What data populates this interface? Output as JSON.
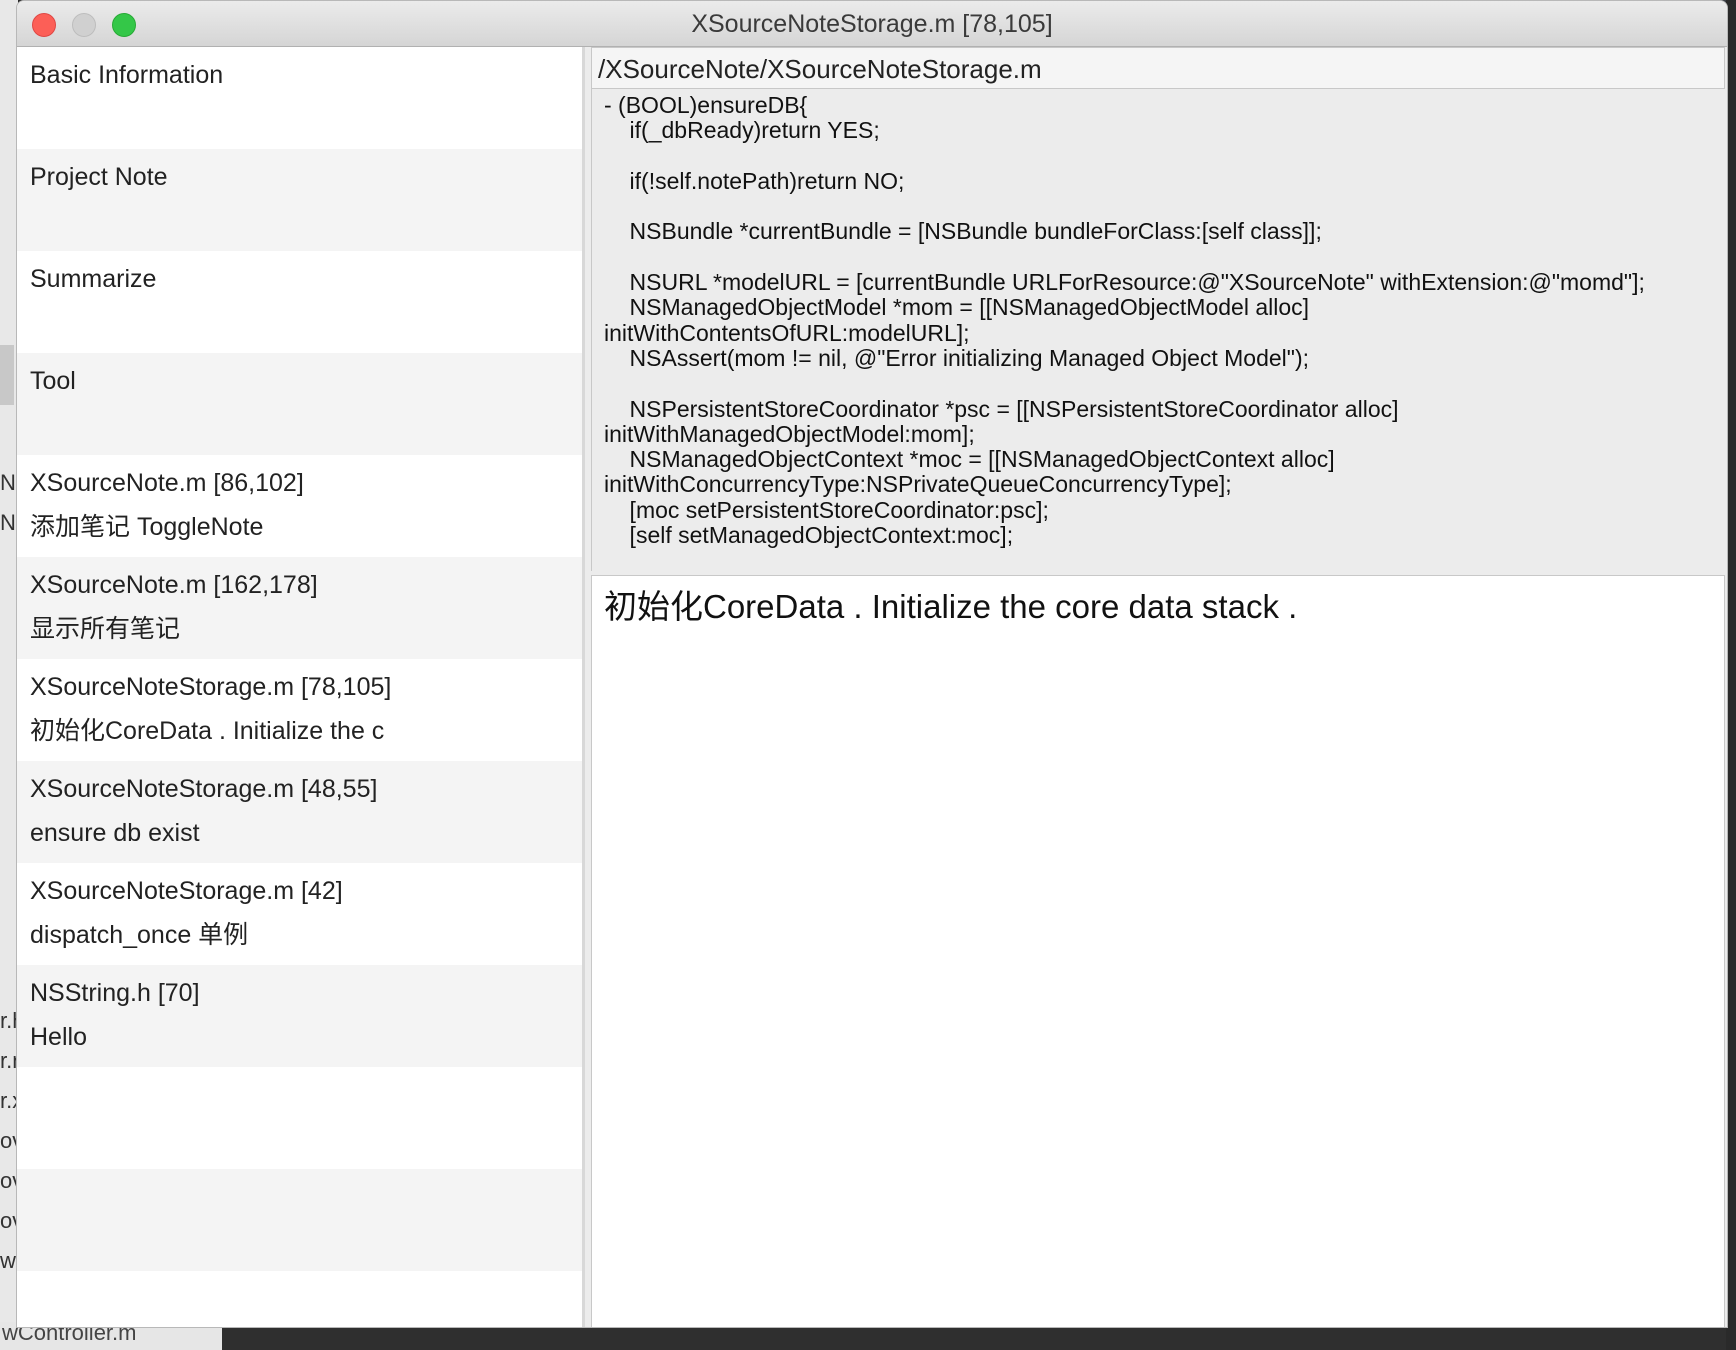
{
  "window": {
    "title": "XSourceNoteStorage.m [78,105]"
  },
  "sidebar": {
    "items": [
      {
        "title": "Basic Information",
        "subtitle": ""
      },
      {
        "title": "Project Note",
        "subtitle": ""
      },
      {
        "title": "Summarize",
        "subtitle": ""
      },
      {
        "title": "Tool",
        "subtitle": ""
      },
      {
        "title": "XSourceNote.m [86,102]",
        "subtitle": "添加笔记 ToggleNote"
      },
      {
        "title": "XSourceNote.m [162,178]",
        "subtitle": "显示所有笔记"
      },
      {
        "title": "XSourceNoteStorage.m [78,105]",
        "subtitle": "初始化CoreData . Initialize the c"
      },
      {
        "title": "XSourceNoteStorage.m [48,55]",
        "subtitle": "ensure db exist"
      },
      {
        "title": "XSourceNoteStorage.m [42]",
        "subtitle": "dispatch_once 单例"
      },
      {
        "title": "NSString.h [70]",
        "subtitle": "Hello"
      },
      {
        "title": "",
        "subtitle": ""
      },
      {
        "title": "",
        "subtitle": ""
      },
      {
        "title": "",
        "subtitle": ""
      }
    ]
  },
  "detail": {
    "file_path": "/XSourceNote/XSourceNoteStorage.m",
    "code_lines": [
      "- (BOOL)ensureDB{",
      "    if(_dbReady)return YES;",
      "",
      "    if(!self.notePath)return NO;",
      "",
      "    NSBundle *currentBundle = [NSBundle bundleForClass:[self class]];",
      "",
      "    NSURL *modelURL = [currentBundle URLForResource:@\"XSourceNote\" withExtension:@\"momd\"];",
      "    NSManagedObjectModel *mom = [[NSManagedObjectModel alloc]",
      "initWithContentsOfURL:modelURL];",
      "    NSAssert(mom != nil, @\"Error initializing Managed Object Model\");",
      "",
      "    NSPersistentStoreCoordinator *psc = [[NSPersistentStoreCoordinator alloc]",
      "initWithManagedObjectModel:mom];",
      "    NSManagedObjectContext *moc = [[NSManagedObjectContext alloc]",
      "initWithConcurrencyType:NSPrivateQueueConcurrencyType];",
      "    [moc setPersistentStoreCoordinator:psc];",
      "    [self setManagedObjectContext:moc];"
    ],
    "note_text": "初始化CoreData . Initialize the core data stack ."
  },
  "background": {
    "left_fragments": [
      "N",
      "N",
      "r.h",
      "r.n",
      "r.x",
      "ov",
      "ov",
      "ov",
      "w("
    ],
    "bottom_text": "wController.m"
  }
}
